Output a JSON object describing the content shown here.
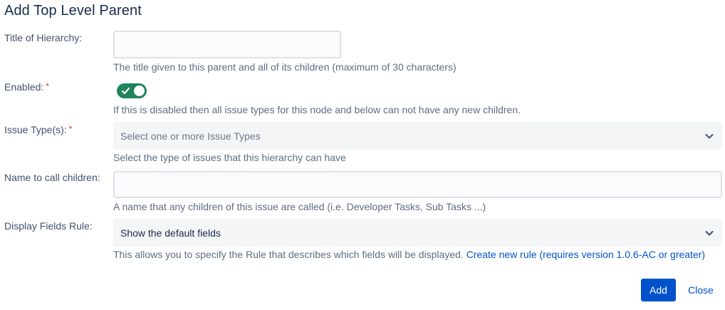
{
  "dialog": {
    "title": "Add Top Level Parent"
  },
  "fields": {
    "title_of_hierarchy": {
      "label": "Title of Hierarchy:",
      "value": "",
      "help": "The title given to this parent and all of its children (maximum of 30 characters)"
    },
    "enabled": {
      "label": "Enabled:",
      "required_marker": "*",
      "checked": true,
      "help": "If this is disabled then all issue types for this node and below can not have any new children."
    },
    "issue_types": {
      "label": "Issue Type(s):",
      "required_marker": "*",
      "placeholder": "Select one or more Issue Types",
      "help": "Select the type of issues that this hierarchy can have"
    },
    "name_to_call_children": {
      "label": "Name to call children:",
      "value": "",
      "help": "A name that any children of this issue are called (i.e. Developer Tasks, Sub Tasks ...)"
    },
    "display_fields_rule": {
      "label": "Display Fields Rule:",
      "selected": "Show the default fields",
      "help": "This allows you to specify the Rule that describes which fields will be displayed.",
      "link": "Create new rule (requires version 1.0.6-AC or greater)"
    }
  },
  "actions": {
    "add_label": "Add",
    "close_label": "Close"
  },
  "colors": {
    "toggle_on": "#1f845a",
    "primary": "#0052cc",
    "required": "#de350b"
  },
  "icons": {
    "toggle": "checkmark-icon",
    "select": "chevron-down-icon"
  }
}
